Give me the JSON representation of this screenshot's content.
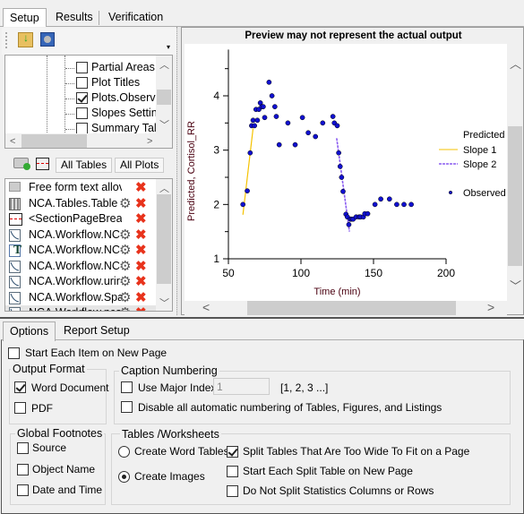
{
  "top_tabs": [
    {
      "label": "Setup",
      "active": true
    },
    {
      "label": "Results"
    },
    {
      "label": "Verification"
    }
  ],
  "tree": {
    "items": [
      {
        "label": "Partial Areas",
        "checked": false
      },
      {
        "label": "Plot Titles",
        "checked": false
      },
      {
        "label": "Plots.Observe",
        "checked": true
      },
      {
        "label": "Slopes Settin",
        "checked": false
      },
      {
        "label": "Summary Tal",
        "checked": false
      }
    ]
  },
  "toolbar2": {
    "all_tables": "All Tables",
    "all_plots": "All Plots"
  },
  "items_list": [
    {
      "label": "Free form text allov",
      "icon": "keyboard-icon",
      "gear": false
    },
    {
      "label": "NCA.Tables.Table",
      "icon": "table-icon",
      "gear": true
    },
    {
      "label": "<SectionPageBrea",
      "icon": "page-break-icon",
      "gear": false
    },
    {
      "label": "NCA.Workflow.NC",
      "icon": "plot-icon",
      "gear": true
    },
    {
      "label": "NCA.Workflow.NC",
      "icon": "text-icon",
      "gear": true
    },
    {
      "label": "NCA.Workflow.NC",
      "icon": "plot-icon",
      "gear": true
    },
    {
      "label": "NCA.Workflow.urir",
      "icon": "plot-icon",
      "gear": true
    },
    {
      "label": "NCA.Workflow.Spa",
      "icon": "plot-icon",
      "gear": true
    },
    {
      "label": "NCA.Workflow.nca",
      "icon": "plot-icon",
      "gear": true
    }
  ],
  "preview": {
    "notice": "Preview may not represent the actual output"
  },
  "chart_data": {
    "type": "scatter",
    "xlabel": "Time (min)",
    "ylabel": "Predicted, Cortisol_RR",
    "xlim": [
      50,
      200
    ],
    "ylim": [
      1,
      4.85
    ],
    "xticks": [
      50,
      100,
      150,
      200
    ],
    "yticks": [
      1,
      2,
      3,
      4
    ],
    "yminor": [
      1.5,
      2.5,
      3.5,
      4.5
    ],
    "legend": {
      "title": "Predicted",
      "placement": "right",
      "entries": [
        "Slope 1",
        "Slope 2",
        "Observed"
      ]
    },
    "colors": {
      "slope1": "#f5c200",
      "slope2": "#8a5cf0",
      "observed": "#1010d0",
      "axis_label": "#4a0010"
    },
    "series": [
      {
        "name": "Observed",
        "type": "scatter",
        "points": [
          [
            60,
            2.0
          ],
          [
            63,
            2.25
          ],
          [
            65,
            2.95
          ],
          [
            66,
            3.45
          ],
          [
            67,
            3.55
          ],
          [
            68,
            3.45
          ],
          [
            69,
            3.75
          ],
          [
            70,
            3.55
          ],
          [
            71,
            3.75
          ],
          [
            72,
            3.87
          ],
          [
            73,
            3.8
          ],
          [
            74,
            3.8
          ],
          [
            75,
            3.6
          ],
          [
            78,
            4.25
          ],
          [
            80,
            4.0
          ],
          [
            82,
            3.8
          ],
          [
            83,
            3.62
          ],
          [
            85,
            3.1
          ],
          [
            91,
            3.5
          ],
          [
            96,
            3.1
          ],
          [
            101,
            3.6
          ],
          [
            105,
            3.32
          ],
          [
            110,
            3.25
          ],
          [
            115,
            3.5
          ],
          [
            122,
            3.62
          ],
          [
            123,
            3.5
          ],
          [
            125,
            3.45
          ],
          [
            126,
            2.95
          ],
          [
            127,
            2.7
          ],
          [
            128,
            2.5
          ],
          [
            129,
            2.24
          ],
          [
            131,
            1.82
          ],
          [
            132,
            1.77
          ],
          [
            133,
            1.63
          ],
          [
            134,
            1.73
          ],
          [
            135,
            1.73
          ],
          [
            136,
            1.73
          ],
          [
            138,
            1.77
          ],
          [
            140,
            1.77
          ],
          [
            141,
            1.77
          ],
          [
            143,
            1.77
          ],
          [
            144,
            1.83
          ],
          [
            146,
            1.83
          ],
          [
            151,
            2.0
          ],
          [
            155,
            2.1
          ],
          [
            161,
            2.1
          ],
          [
            166,
            2.0
          ],
          [
            171,
            2.0
          ],
          [
            176,
            2.0
          ]
        ]
      },
      {
        "name": "Slope 1",
        "type": "line",
        "points": [
          [
            60,
            1.81
          ],
          [
            67,
            3.4
          ]
        ]
      },
      {
        "name": "Slope 2",
        "type": "line",
        "points": [
          [
            124.6,
            3.22
          ],
          [
            133.4,
            1.5
          ]
        ]
      }
    ]
  },
  "bottom_tabs": [
    {
      "label": "Options",
      "active": true
    },
    {
      "label": "Report Setup"
    }
  ],
  "options": {
    "start_each_item": {
      "label": "Start Each Item on New Page",
      "checked": false
    },
    "output_format": {
      "title": "Output Format",
      "word": {
        "label": "Word Document",
        "checked": true
      },
      "pdf": {
        "label": "PDF",
        "checked": false
      }
    },
    "caption": {
      "title": "Caption Numbering",
      "major_index": {
        "label": "Use Major Index",
        "checked": false,
        "value": "1",
        "hint": "[1, 2, 3 ...]"
      },
      "disable": {
        "label": "Disable all automatic numbering of Tables, Figures, and Listings",
        "checked": false
      }
    },
    "footnotes": {
      "title": "Global Footnotes",
      "source": {
        "label": "Source",
        "checked": false
      },
      "object_name": {
        "label": "Object Name",
        "checked": false
      },
      "date_time": {
        "label": "Date and Time",
        "checked": false
      }
    },
    "tables": {
      "title": "Tables /Worksheets",
      "create_word": {
        "label": "Create Word Tables",
        "selected": false
      },
      "create_images": {
        "label": "Create Images",
        "selected": true
      },
      "split_wide": {
        "label": "Split Tables That Are Too Wide To Fit on a Page",
        "checked": true
      },
      "start_split": {
        "label": "Start Each Split Table on New Page",
        "checked": false
      },
      "no_split_stats": {
        "label": "Do Not Split Statistics Columns or Rows",
        "checked": false
      }
    }
  }
}
